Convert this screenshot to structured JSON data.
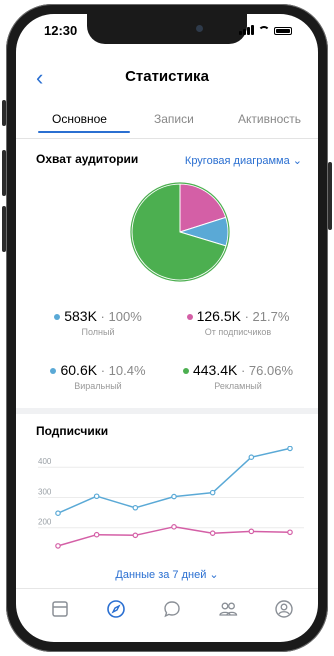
{
  "status_bar": {
    "time": "12:30"
  },
  "header": {
    "title": "Статистика",
    "back_icon": "chevron-left-icon"
  },
  "tabs": [
    {
      "label": "Основное",
      "active": true
    },
    {
      "label": "Записи",
      "active": false
    },
    {
      "label": "Активность",
      "active": false
    }
  ],
  "reach": {
    "title": "Охват аудитории",
    "chart_type_label": "Круговая диаграмма ⌄",
    "stats": [
      {
        "value": "583K",
        "percent": "100%",
        "label": "Полный",
        "color": "#5aa9d6"
      },
      {
        "value": "126.5K",
        "percent": "21.7%",
        "label": "От подписчиков",
        "color": "#d45fa6"
      },
      {
        "value": "60.6K",
        "percent": "10.4%",
        "label": "Виральный",
        "color": "#5aa9d6"
      },
      {
        "value": "443.4K",
        "percent": "76.06%",
        "label": "Рекламный",
        "color": "#4caf50"
      }
    ]
  },
  "subscribers": {
    "title": "Подписчики",
    "period_label": "Данные за 7 дней ⌄"
  },
  "bottom_nav": [
    {
      "icon": "feed-icon",
      "active": false
    },
    {
      "icon": "compass-icon",
      "active": true
    },
    {
      "icon": "message-icon",
      "active": false
    },
    {
      "icon": "friends-icon",
      "active": false
    },
    {
      "icon": "profile-icon",
      "active": false
    }
  ],
  "chart_data": [
    {
      "type": "pie",
      "categories": [
        "Рекламный",
        "От подписчиков",
        "Виральный"
      ],
      "values": [
        76.06,
        21.7,
        10.4
      ],
      "colors": [
        "#4caf50",
        "#d45fa6",
        "#5aa9d6"
      ]
    },
    {
      "type": "line",
      "title": "Подписчики",
      "x": [
        1,
        2,
        3,
        4,
        5,
        6,
        7,
        8
      ],
      "ylim": [
        100,
        470
      ],
      "y_ticks": [
        "400",
        "300",
        "200"
      ],
      "series": [
        {
          "values": [
            248,
            304,
            266,
            303,
            316,
            433,
            462
          ],
          "color": "#5aa9d6"
        },
        {
          "values": [
            140,
            177,
            175,
            203,
            182,
            188,
            185
          ],
          "color": "#d45fa6"
        }
      ]
    }
  ]
}
